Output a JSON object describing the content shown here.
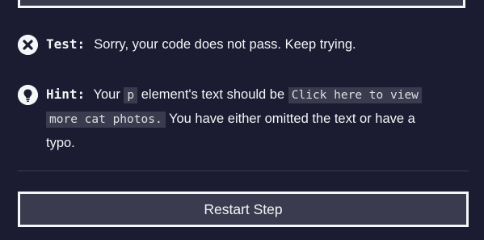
{
  "test": {
    "label": "Test:",
    "message": "Sorry, your code does not pass. Keep trying.",
    "icon": "close-circle-icon"
  },
  "hint": {
    "label": "Hint:",
    "part1": "Your",
    "code1": "p",
    "part2": "element's text should be",
    "code2a": "Click here to view",
    "code2b": "more cat photos.",
    "part3": "You have either omitted the text or have a",
    "part4": "typo.",
    "icon": "lightbulb-icon"
  },
  "actions": {
    "restart_label": "Restart Step"
  },
  "colors": {
    "background": "#1b1b32",
    "button_bg": "#3b3b4f",
    "text": "#f5f6f7"
  }
}
